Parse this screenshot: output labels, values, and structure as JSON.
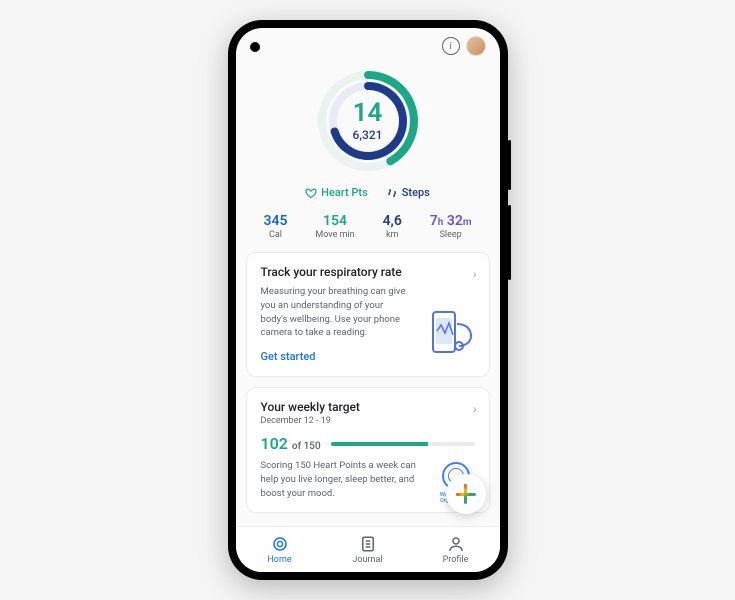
{
  "ring": {
    "heart_pts": "14",
    "steps": "6,321",
    "heart_pct": 42,
    "steps_pct": 70
  },
  "legend": {
    "heart": "Heart Pts",
    "steps": "Steps"
  },
  "stats": {
    "cal": {
      "value": "345",
      "label": "Cal"
    },
    "move": {
      "value": "154",
      "label": "Move min"
    },
    "km": {
      "value": "4,6",
      "label": "km"
    },
    "sleep": {
      "h": "7",
      "hu": "h",
      "m": "32",
      "mu": "m",
      "label": "Sleep"
    }
  },
  "card_resp": {
    "title": "Track your respiratory rate",
    "body": "Measuring your breathing can give you an understanding of your body's wellbeing. Use your phone camera to take a reading.",
    "cta": "Get started"
  },
  "card_weekly": {
    "title": "Your weekly target",
    "date": "December 12 - 19",
    "value": "102",
    "of": "of 150",
    "body": "Scoring 150 Heart Points a week can help you live longer, sleep better, and boost your mood.",
    "who": "World Health Organization"
  },
  "nav": {
    "home": "Home",
    "journal": "Journal",
    "profile": "Profile"
  }
}
